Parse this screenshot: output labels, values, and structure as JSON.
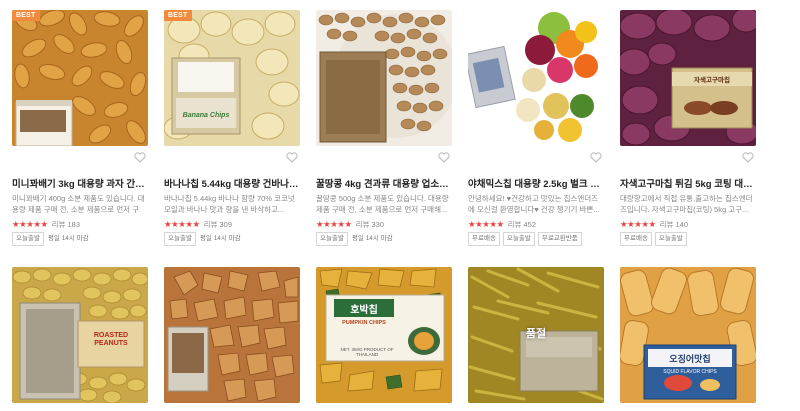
{
  "products": [
    {
      "badge": "BEST",
      "title": "미니꽈배기 3kg 대용량 과자 간식 스...",
      "desc": "미니꽈배기 400g 소분 제품도 있습니다. 대용량 제품 구매 전, 소분 제품으로 먼저 구매...",
      "stars": "★★★★★",
      "reviews": "리뷰 183",
      "tags": [
        "오늘출발"
      ],
      "tag_plain": "평일 14시 마감",
      "image": "twisted-snack-image"
    },
    {
      "badge": "BEST",
      "title": "바나나칩 5.44kg 대용량 건바나나 업...",
      "desc": "바나나칩 5.44kg 바나나 함량 70% 코코넛오일과 바나나 맛과 향을 낸 바삭하고...",
      "stars": "★★★★★",
      "reviews": "리뷰 309",
      "tags": [
        "오늘출발"
      ],
      "tag_plain": "평일 14시 마감",
      "package_label": "Banana Chips",
      "image": "banana-chips-image"
    },
    {
      "title": "꿀땅콩 4kg 견과류 대용량 업소용 주...",
      "desc": "꿀땅콩 500g 소분 제품도 있습니다. 대용량 제품 구매 전, 소분 제품으로 먼저 구매해...",
      "stars": "★★★★★",
      "reviews": "리뷰 330",
      "tags": [
        "오늘출발"
      ],
      "tag_plain": "평일 14시 마감",
      "image": "honey-peanut-image"
    },
    {
      "title": "야채믹스칩 대용량 2.5kg 벌크 업소용...",
      "desc": "안녕하세요! ♥건강하고 맛있는 칩스앤더즈에 오신걸 환영합니다♥ 건강 챙기기 바쁜...",
      "stars": "★★★★★",
      "reviews": "리뷰 452",
      "tags": [
        "무료배송",
        "오늘출발",
        "무료교환반품"
      ],
      "image": "veggie-chips-image"
    },
    {
      "title": "자색고구마칩 튀김 5kg 코팅 대용량과...",
      "desc": "대량향고에서 직접 유통,출고하는 칩스앤더즈입니다. 자색고구마칩(코팅) 5kg 고구...",
      "stars": "★★★★★",
      "reviews": "리뷰 140",
      "tags": [
        "무료배송",
        "오늘출발"
      ],
      "package_label": "자색고구마칩",
      "image": "purple-sweet-potato-image"
    },
    {
      "package_label": "ROASTED PEANUTS",
      "image": "roasted-peanuts-image"
    },
    {
      "image": "caramel-snack-image"
    },
    {
      "package_label": "호박칩",
      "package_sub": "PUMPKIN CHIPS",
      "package_foot": "NET. 350G  PRODUCT OF THAILAND",
      "image": "pumpkin-chips-image"
    },
    {
      "overlay": "품절",
      "image": "potato-sticks-image"
    },
    {
      "package_label": "오징어맛칩",
      "package_sub": "SQUID FLAVOR CHIPS",
      "image": "squid-chips-image"
    }
  ],
  "colors": {
    "badge": "#f08a3c",
    "stars": "#e8433f",
    "muted": "#888888"
  }
}
